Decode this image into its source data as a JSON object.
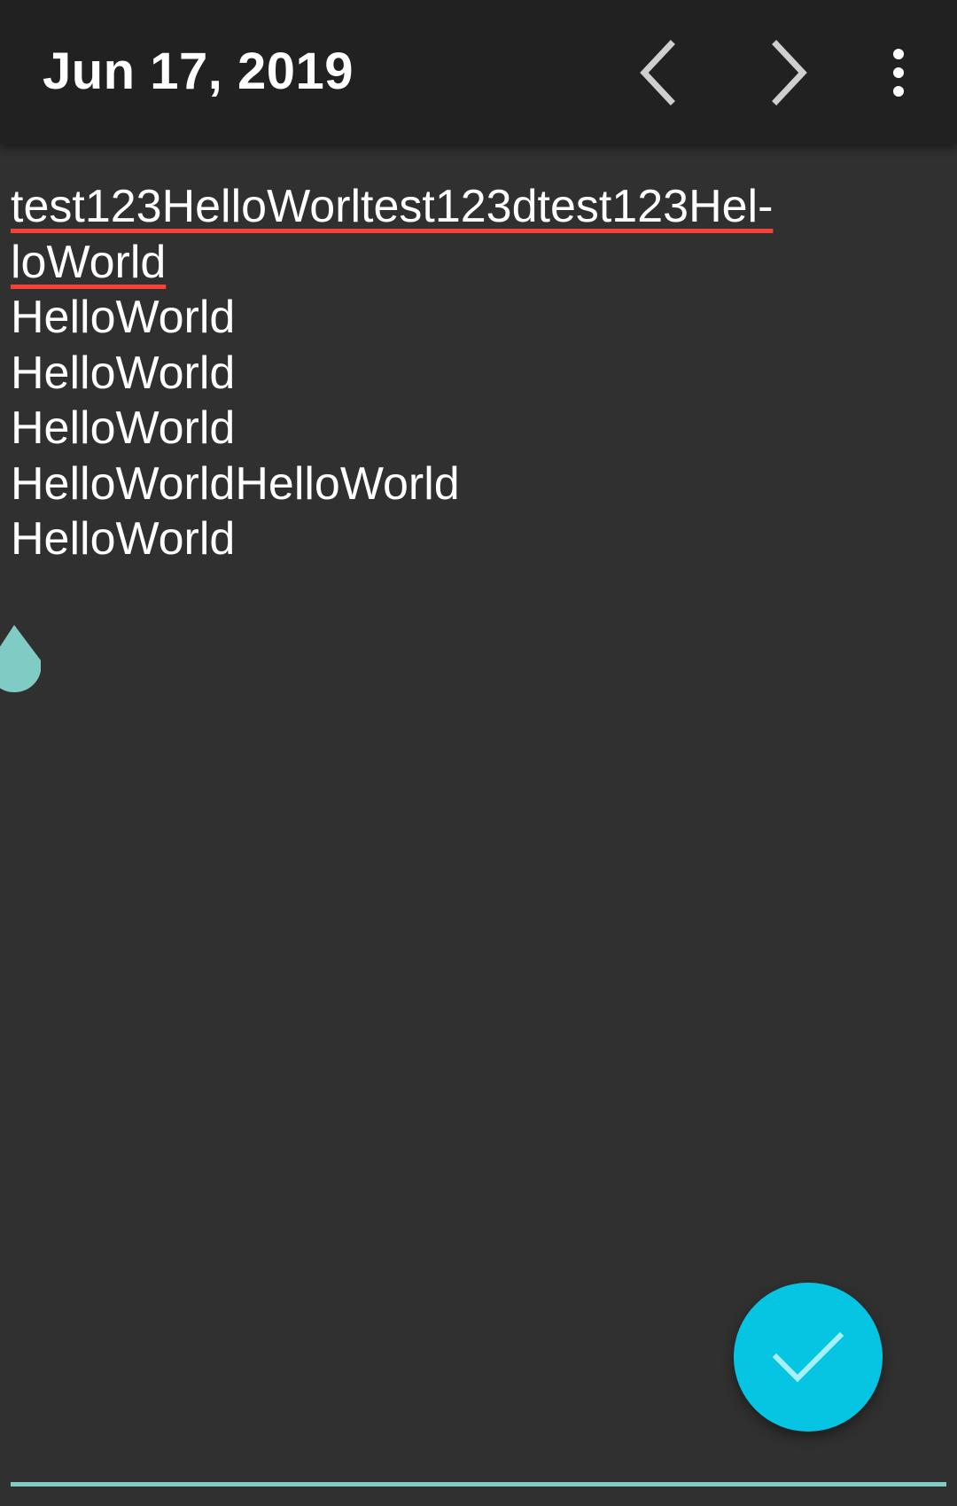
{
  "toolbar": {
    "date_title": "Jun 17, 2019",
    "prev_icon": "chevron-left-icon",
    "next_icon": "chevron-right-icon",
    "more_icon": "more-vert-icon"
  },
  "editor": {
    "lines": [
      "test123HelloWorltest123dtest123Hel-",
      "loWorld",
      "HelloWorld",
      "HelloWorld",
      "HelloWorld",
      "HelloWorldHelloWorld",
      "HelloWorld"
    ]
  },
  "fab": {
    "icon": "check-icon",
    "color": "#06c5e3"
  },
  "colors": {
    "background": "#303030",
    "toolbar": "#212121",
    "spellcheck_underline": "#f44336",
    "accent_teal": "#80cbc4"
  }
}
